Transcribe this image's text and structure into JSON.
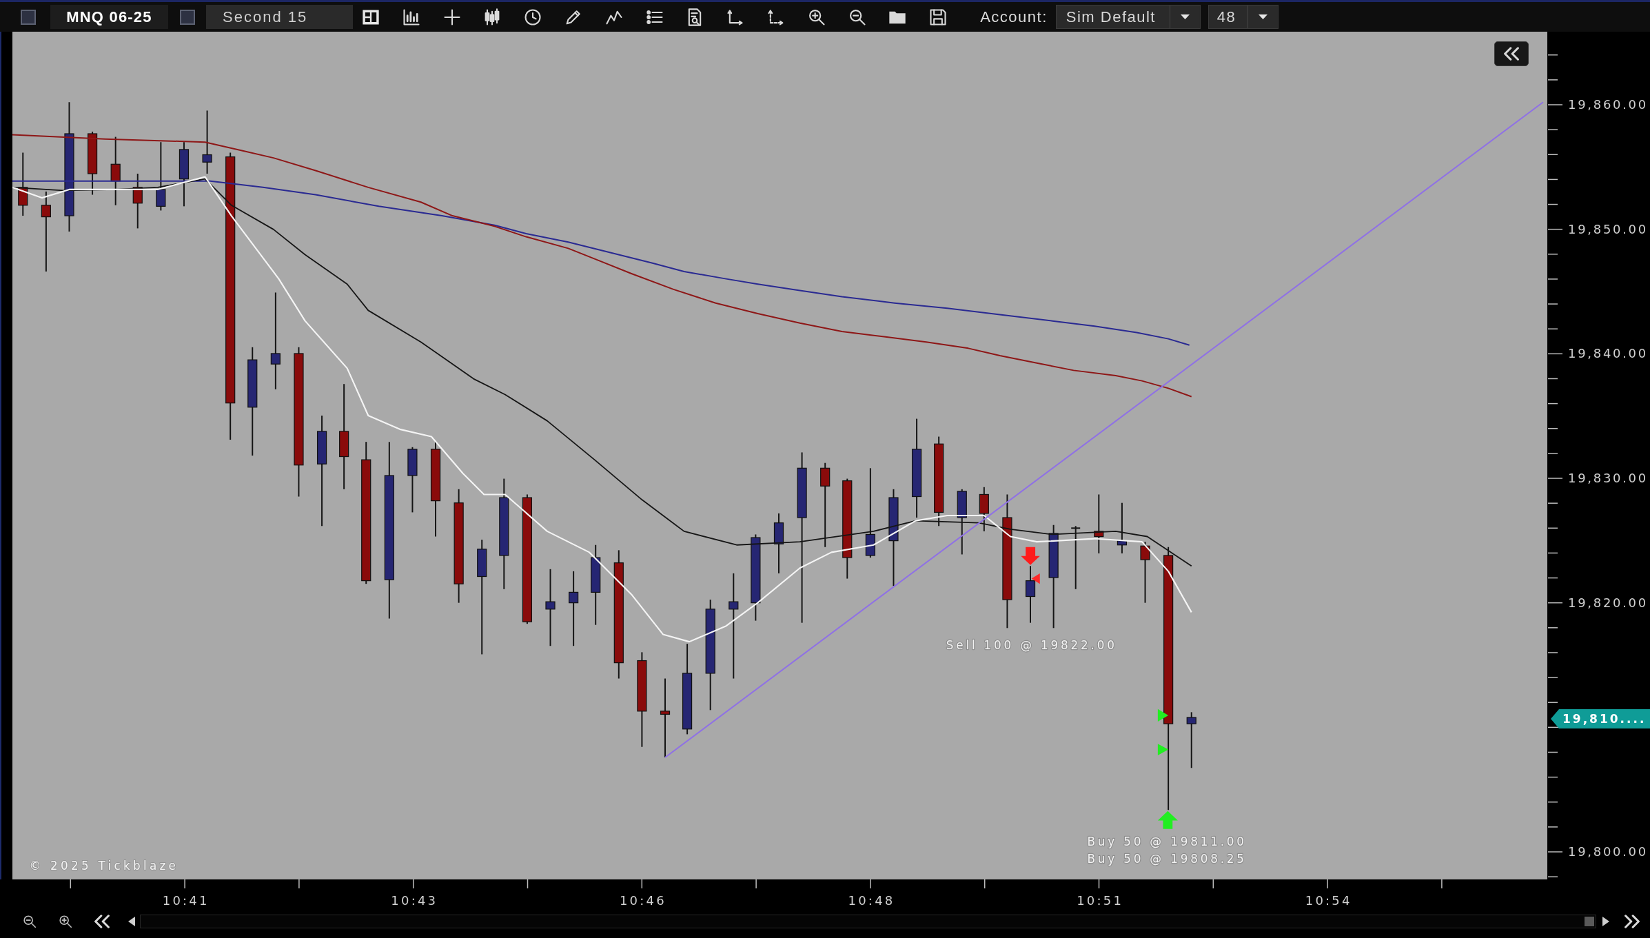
{
  "toolbar": {
    "instrument": "MNQ 06-25",
    "period": "Second 15",
    "account_label": "Account:",
    "account": "Sim Default",
    "quantity": "48"
  },
  "chart": {
    "trade_labels": [
      "Sell 100 @ 19822.00",
      "Buy 50 @ 19811.00",
      "Buy 50 @ 19808.25"
    ],
    "copyright": "© 2025 Tickblaze"
  },
  "price_axis": {
    "labels": [
      "19,860.00",
      "19,850.00",
      "19,840.00",
      "19,830.00",
      "19,820.00",
      "19,800.00"
    ],
    "current_price": "19,810...."
  },
  "time_axis": {
    "labels": [
      "10:41",
      "10:43",
      "10:46",
      "10:48",
      "10:51",
      "10:54"
    ]
  }
}
